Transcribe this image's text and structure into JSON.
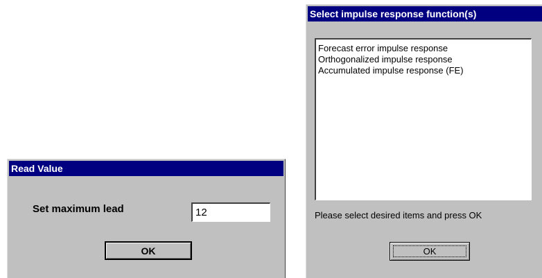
{
  "read_value_dialog": {
    "title": "Read Value",
    "prompt_label": "Set maximum lead",
    "input_value": "12",
    "ok_label": "OK"
  },
  "select_dialog": {
    "title": "Select impulse response function(s)",
    "items": [
      {
        "label": "Forecast error impulse response"
      },
      {
        "label": "Orthogonalized impulse response"
      },
      {
        "label": "Accumulated impulse response (FE)"
      }
    ],
    "hint": "Please select desired items and press OK",
    "ok_label": "OK"
  },
  "colors": {
    "titlebar_bg": "#000080",
    "titlebar_text": "#ffffff",
    "dialog_bg": "#c0c0c0"
  }
}
